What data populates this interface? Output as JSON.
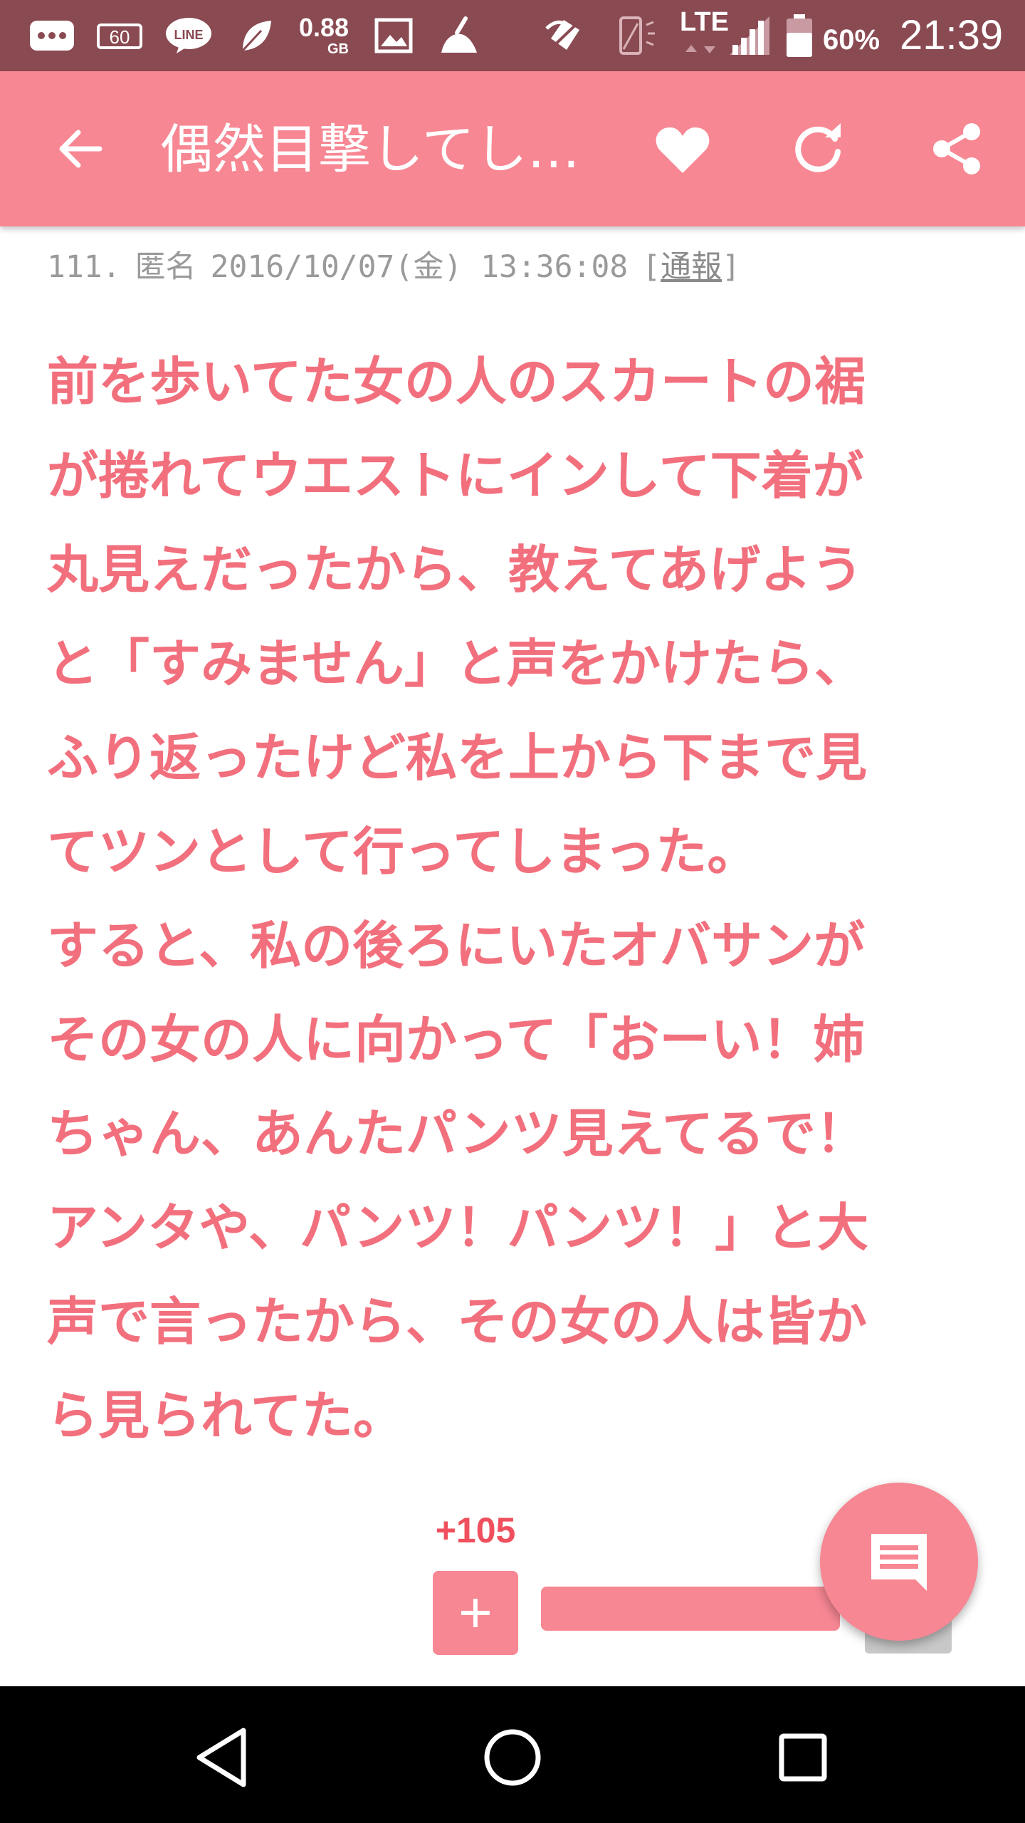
{
  "status_bar": {
    "data_size": "0.88",
    "data_unit": "GB",
    "network": "LTE",
    "battery": "60%",
    "time": "21:39"
  },
  "toolbar": {
    "title": "偶然目撃してし…"
  },
  "post": {
    "number": "111.",
    "author": "匿名",
    "datetime": "2016/10/07(金) 13:36:08",
    "report_open": "[",
    "report_label": "通報",
    "report_close": "]",
    "body_lines": [
      "前を歩いてた女の人のスカートの裾",
      "が捲れてウエストにインして下着が",
      "丸見えだったから、教えてあげよう",
      "と「すみません」と声をかけたら、",
      "ふり返ったけど私を上から下まで見",
      "てツンとして行ってしまった。",
      "すると、私の後ろにいたオバサンが",
      "その女の人に向かって「おーい！姉",
      "ちゃん、あんたパンツ見えてるで！",
      "アンタや、パンツ！パンツ！」と大",
      "声で言ったから、その女の人は皆か",
      "ら見られてた。"
    ],
    "vote_count": "+105",
    "vote_plus_label": "+"
  },
  "colors": {
    "accent": "#f78793",
    "body_text": "#f2707d",
    "status_bar": "#8a4a52"
  }
}
